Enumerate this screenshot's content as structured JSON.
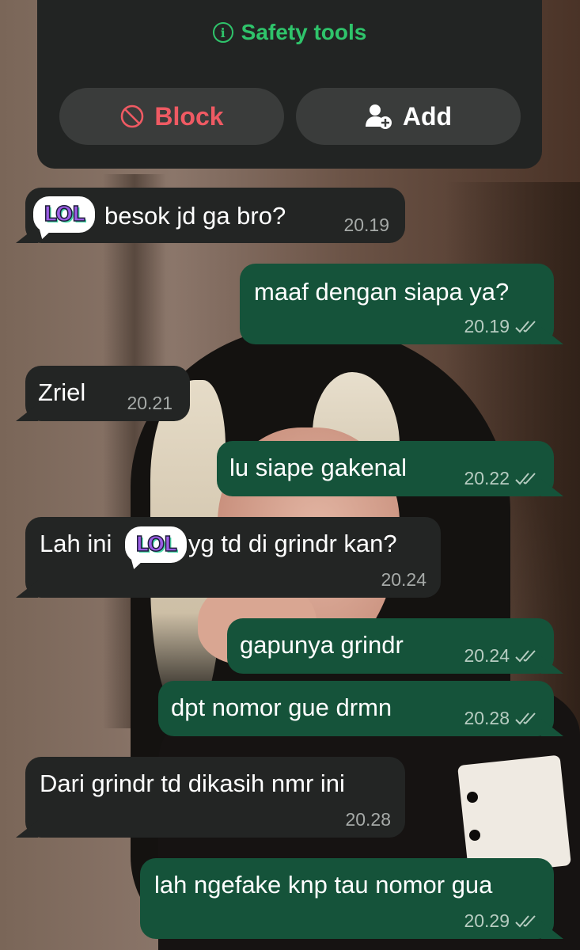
{
  "header": {
    "safety_tools_label": "Safety tools",
    "block_label": "Block",
    "add_label": "Add"
  },
  "sticker": {
    "text": "LOL"
  },
  "messages": [
    {
      "direction": "incoming",
      "text": "besok jd ga bro?",
      "time": "20.19",
      "sticker": "lol-sticker"
    },
    {
      "direction": "outgoing",
      "text": "maaf dengan siapa ya?",
      "time": "20.19",
      "read": true
    },
    {
      "direction": "incoming",
      "text": "Zriel",
      "time": "20.21"
    },
    {
      "direction": "outgoing",
      "text": "lu siape gakenal",
      "time": "20.22",
      "read": true
    },
    {
      "direction": "incoming",
      "text_before": "Lah ini",
      "text_after": "yg td di grindr kan?",
      "time": "20.24",
      "sticker": "lol-sticker"
    },
    {
      "direction": "outgoing",
      "text": "gapunya grindr",
      "time": "20.24",
      "read": true
    },
    {
      "direction": "outgoing",
      "text": "dpt nomor gue drmn",
      "time": "20.28",
      "read": true
    },
    {
      "direction": "incoming",
      "text": "Dari grindr td dikasih nmr ini",
      "time": "20.28"
    },
    {
      "direction": "outgoing",
      "text": "lah ngefake knp tau nomor gua",
      "time": "20.29",
      "read": true
    }
  ],
  "colors": {
    "accent_green": "#2fc46b",
    "block_red": "#ef5a63",
    "incoming_bubble": "#232524",
    "outgoing_bubble": "#15533a"
  }
}
